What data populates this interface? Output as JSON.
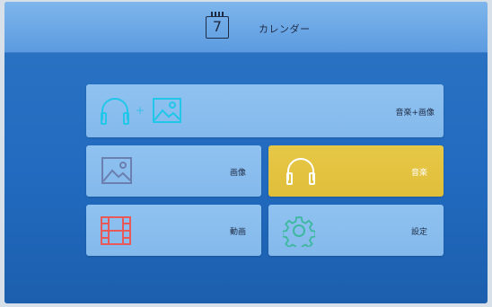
{
  "header": {
    "icon": "calendar-icon",
    "day": "7",
    "title": "カレンダー"
  },
  "tiles": [
    {
      "id": "music-photo",
      "label": "音楽+画像",
      "icons": [
        "headphones-icon",
        "image-icon"
      ],
      "plus": "+",
      "selected": false
    },
    {
      "id": "photo",
      "label": "画像",
      "icons": [
        "image-icon"
      ],
      "selected": false
    },
    {
      "id": "music",
      "label": "音楽",
      "icons": [
        "headphones-icon"
      ],
      "selected": true
    },
    {
      "id": "video",
      "label": "動画",
      "icons": [
        "film-icon"
      ],
      "selected": false
    },
    {
      "id": "settings",
      "label": "設定",
      "icons": [
        "gear-icon"
      ],
      "selected": false
    }
  ],
  "colors": {
    "background": "#226bc0",
    "topbar": "#6aa6e6",
    "tile": "#8cc0ef",
    "tile_selected": "#e3c440",
    "headphones_accent": "#22c6e8",
    "image_icon": "#6b7fb0",
    "film_icon": "#e85a5a",
    "gear_icon": "#3fb8a0"
  }
}
